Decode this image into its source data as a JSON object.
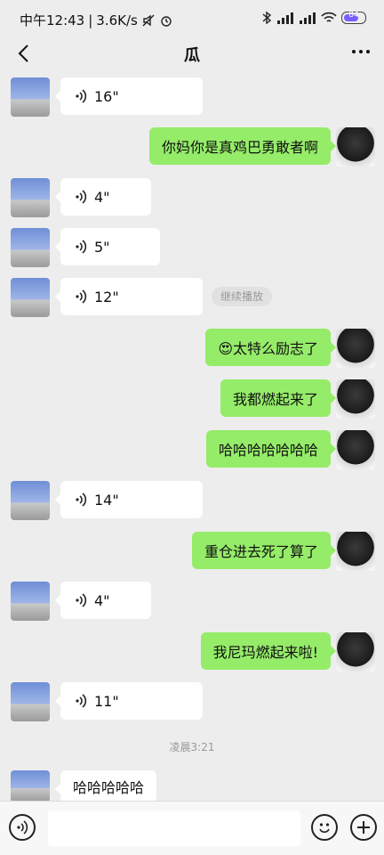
{
  "status_bar": {
    "time": "中午12:43",
    "net_speed": "3.6K/s",
    "battery": "84"
  },
  "header": {
    "title": "瓜"
  },
  "messages": [
    {
      "text": "16\""
    },
    {
      "text": "你妈你是真鸡巴勇敢者啊"
    },
    {
      "text": "4\""
    },
    {
      "text": "5\""
    },
    {
      "text": "12\""
    },
    {
      "text": "😍太特么励志了"
    },
    {
      "text": "我都燃起来了"
    },
    {
      "text": "哈哈哈哈哈哈哈"
    },
    {
      "text": "14\""
    },
    {
      "text": "重仓进去死了算了"
    },
    {
      "text": "4\""
    },
    {
      "text": "我尼玛燃起来啦!"
    },
    {
      "text": "11\""
    },
    {
      "text": "哈哈哈哈哈"
    }
  ],
  "continue_playback": "继续播放",
  "timestamp": "凌晨3:21",
  "input_bar": {
    "placeholder": ""
  }
}
